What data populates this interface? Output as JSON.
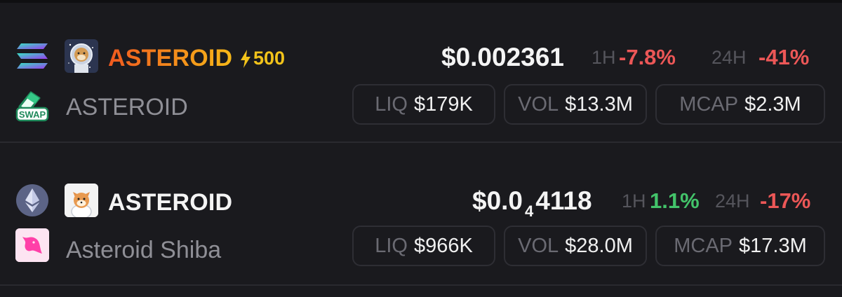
{
  "tokens": [
    {
      "chain_icon": "solana-icon",
      "dex_icon": "swap-icon",
      "dex_icon_text": "SWAP",
      "symbol": "ASTEROID",
      "symbol_style": "orange-gradient",
      "boost": "500",
      "boost_icon": "lightning-icon",
      "name": "ASTEROID",
      "price": "$0.002361",
      "price_prefix": "",
      "price_subscript": "",
      "price_suffix": "",
      "h1_label": "1H",
      "h1_change": "-7.8%",
      "h24_label": "24H",
      "h24_change": "-41%",
      "liq_label": "LIQ",
      "liq": "$179K",
      "vol_label": "VOL",
      "vol": "$13.3M",
      "mcap_label": "MCAP",
      "mcap": "$2.3M"
    },
    {
      "chain_icon": "ethereum-icon",
      "dex_icon": "uniswap-icon",
      "symbol": "ASTEROID",
      "boost": "",
      "name": "Asteroid Shiba",
      "price_prefix": "$0.0",
      "price_subscript": "4",
      "price_suffix": "4118",
      "h1_label": "1H",
      "h1_change": "1.1%",
      "h24_label": "24H",
      "h24_change": "-17%",
      "liq_label": "LIQ",
      "liq": "$966K",
      "vol_label": "VOL",
      "vol": "$28.0M",
      "mcap_label": "MCAP",
      "mcap": "$17.3M"
    }
  ],
  "colors": {
    "background": "#1a1a1e",
    "negative": "#ec5757",
    "positive": "#43c36a",
    "boost": "#f2c31a",
    "symbol_gradient_start": "#f0591f",
    "symbol_gradient_end": "#f6b818"
  }
}
